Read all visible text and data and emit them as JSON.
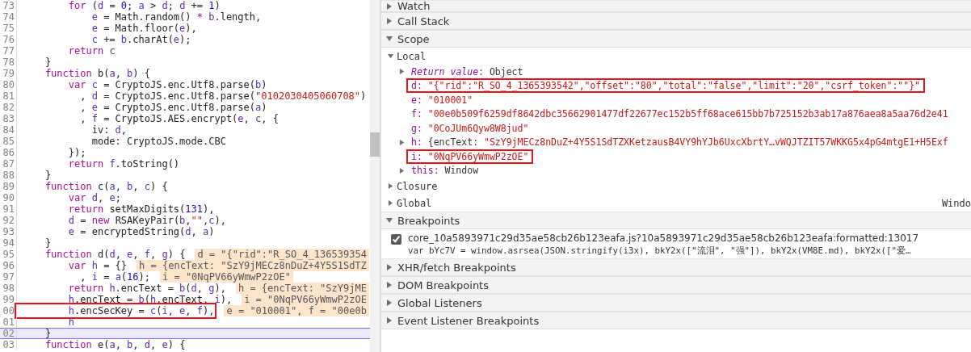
{
  "editor": {
    "lines": [
      {
        "number": "73",
        "tokens": [
          {
            "kind": "keyword",
            "text": "        for"
          },
          {
            "kind": "plain",
            "text": " ("
          },
          {
            "kind": "variable",
            "text": "d"
          },
          {
            "kind": "plain",
            "text": " = "
          },
          {
            "kind": "number",
            "text": "0"
          },
          {
            "kind": "plain",
            "text": "; "
          },
          {
            "kind": "variable",
            "text": "a"
          },
          {
            "kind": "plain",
            "text": " > "
          },
          {
            "kind": "variable",
            "text": "d"
          },
          {
            "kind": "plain",
            "text": "; "
          },
          {
            "kind": "variable",
            "text": "d"
          },
          {
            "kind": "plain",
            "text": " += "
          },
          {
            "kind": "number",
            "text": "1"
          },
          {
            "kind": "plain",
            "text": ")"
          }
        ]
      },
      {
        "number": "74",
        "tokens": [
          {
            "kind": "variable",
            "text": "            e"
          },
          {
            "kind": "plain",
            "text": " = Math.random() "
          },
          {
            "kind": "keyword",
            "text": "*"
          },
          {
            "kind": "variable",
            "text": " b"
          },
          {
            "kind": "plain",
            "text": ".length,"
          }
        ]
      },
      {
        "number": "75",
        "tokens": [
          {
            "kind": "variable",
            "text": "            e"
          },
          {
            "kind": "plain",
            "text": " = Math.floor("
          },
          {
            "kind": "variable",
            "text": "e"
          },
          {
            "kind": "plain",
            "text": "),"
          }
        ]
      },
      {
        "number": "76",
        "tokens": [
          {
            "kind": "variable",
            "text": "            c"
          },
          {
            "kind": "plain",
            "text": " += "
          },
          {
            "kind": "variable",
            "text": "b"
          },
          {
            "kind": "plain",
            "text": ".charAt("
          },
          {
            "kind": "variable",
            "text": "e"
          },
          {
            "kind": "plain",
            "text": ");"
          }
        ]
      },
      {
        "number": "77",
        "tokens": [
          {
            "kind": "keyword",
            "text": "        return"
          },
          {
            "kind": "variable",
            "text": " c"
          }
        ]
      },
      {
        "number": "78",
        "tokens": [
          {
            "kind": "plain",
            "text": "    }"
          }
        ]
      },
      {
        "number": "79",
        "tokens": [
          {
            "kind": "keyword",
            "text": "    function"
          },
          {
            "kind": "plain",
            "text": " b("
          },
          {
            "kind": "variable",
            "text": "a"
          },
          {
            "kind": "plain",
            "text": ", "
          },
          {
            "kind": "variable",
            "text": "b"
          },
          {
            "kind": "plain",
            "text": ") {"
          }
        ]
      },
      {
        "number": "80",
        "tokens": [
          {
            "kind": "keyword",
            "text": "        var"
          },
          {
            "kind": "variable",
            "text": " c"
          },
          {
            "kind": "plain",
            "text": " = CryptoJS.enc.Utf8.parse("
          },
          {
            "kind": "variable",
            "text": "b"
          },
          {
            "kind": "plain",
            "text": ")"
          }
        ]
      },
      {
        "number": "81",
        "tokens": [
          {
            "kind": "plain",
            "text": "          , "
          },
          {
            "kind": "variable",
            "text": "d"
          },
          {
            "kind": "plain",
            "text": " = CryptoJS.enc.Utf8.parse("
          },
          {
            "kind": "string",
            "text": "\"0102030405060708\""
          },
          {
            "kind": "plain",
            "text": ")"
          }
        ]
      },
      {
        "number": "82",
        "tokens": [
          {
            "kind": "plain",
            "text": "          , "
          },
          {
            "kind": "variable",
            "text": "e"
          },
          {
            "kind": "plain",
            "text": " = CryptoJS.enc.Utf8.parse("
          },
          {
            "kind": "variable",
            "text": "a"
          },
          {
            "kind": "plain",
            "text": ")"
          }
        ]
      },
      {
        "number": "83",
        "tokens": [
          {
            "kind": "plain",
            "text": "          , "
          },
          {
            "kind": "variable",
            "text": "f"
          },
          {
            "kind": "plain",
            "text": " = CryptoJS.AES.encrypt("
          },
          {
            "kind": "variable",
            "text": "e"
          },
          {
            "kind": "plain",
            "text": ", "
          },
          {
            "kind": "variable",
            "text": "c"
          },
          {
            "kind": "plain",
            "text": ", {"
          }
        ]
      },
      {
        "number": "84",
        "tokens": [
          {
            "kind": "plain",
            "text": "            iv: "
          },
          {
            "kind": "variable",
            "text": "d"
          },
          {
            "kind": "plain",
            "text": ","
          }
        ]
      },
      {
        "number": "85",
        "tokens": [
          {
            "kind": "plain",
            "text": "            mode: CryptoJS.mode.CBC"
          }
        ]
      },
      {
        "number": "86",
        "tokens": [
          {
            "kind": "plain",
            "text": "        });"
          }
        ]
      },
      {
        "number": "87",
        "tokens": [
          {
            "kind": "keyword",
            "text": "        return"
          },
          {
            "kind": "variable",
            "text": " f"
          },
          {
            "kind": "plain",
            "text": ".toString()"
          }
        ]
      },
      {
        "number": "88",
        "tokens": [
          {
            "kind": "plain",
            "text": "    }"
          }
        ]
      },
      {
        "number": "89",
        "tokens": [
          {
            "kind": "keyword",
            "text": "    function"
          },
          {
            "kind": "plain",
            "text": " c("
          },
          {
            "kind": "variable",
            "text": "a"
          },
          {
            "kind": "plain",
            "text": ", "
          },
          {
            "kind": "variable",
            "text": "b"
          },
          {
            "kind": "plain",
            "text": ", "
          },
          {
            "kind": "variable",
            "text": "c"
          },
          {
            "kind": "plain",
            "text": ") {"
          }
        ]
      },
      {
        "number": "90",
        "tokens": [
          {
            "kind": "keyword",
            "text": "        var"
          },
          {
            "kind": "variable",
            "text": " d"
          },
          {
            "kind": "plain",
            "text": ", "
          },
          {
            "kind": "variable",
            "text": "e"
          },
          {
            "kind": "plain",
            "text": ";"
          }
        ]
      },
      {
        "number": "91",
        "tokens": [
          {
            "kind": "keyword",
            "text": "        return"
          },
          {
            "kind": "plain",
            "text": " setMaxDigits("
          },
          {
            "kind": "number",
            "text": "131"
          },
          {
            "kind": "plain",
            "text": "),"
          }
        ]
      },
      {
        "number": "92",
        "tokens": [
          {
            "kind": "variable",
            "text": "        d"
          },
          {
            "kind": "plain",
            "text": " = "
          },
          {
            "kind": "keyword",
            "text": "new"
          },
          {
            "kind": "plain",
            "text": " RSAKeyPair("
          },
          {
            "kind": "variable",
            "text": "b"
          },
          {
            "kind": "plain",
            "text": ","
          },
          {
            "kind": "string",
            "text": "\"\""
          },
          {
            "kind": "plain",
            "text": ","
          },
          {
            "kind": "variable",
            "text": "c"
          },
          {
            "kind": "plain",
            "text": "),"
          }
        ]
      },
      {
        "number": "93",
        "tokens": [
          {
            "kind": "variable",
            "text": "        e"
          },
          {
            "kind": "plain",
            "text": " = encryptedString("
          },
          {
            "kind": "variable",
            "text": "d"
          },
          {
            "kind": "plain",
            "text": ", "
          },
          {
            "kind": "variable",
            "text": "a"
          },
          {
            "kind": "plain",
            "text": ")"
          }
        ]
      },
      {
        "number": "94",
        "tokens": [
          {
            "kind": "plain",
            "text": "    }"
          }
        ]
      },
      {
        "number": "95",
        "tokens": [
          {
            "kind": "keyword",
            "text": "    function"
          },
          {
            "kind": "plain",
            "text": " d("
          },
          {
            "kind": "variable",
            "text": "d"
          },
          {
            "kind": "plain",
            "text": ", "
          },
          {
            "kind": "variable",
            "text": "e"
          },
          {
            "kind": "plain",
            "text": ", "
          },
          {
            "kind": "variable",
            "text": "f"
          },
          {
            "kind": "plain",
            "text": ", "
          },
          {
            "kind": "variable",
            "text": "g"
          },
          {
            "kind": "plain",
            "text": ") {"
          }
        ],
        "inline_value": "d = \"{\"rid\":\"R_SO_4_136539354"
      },
      {
        "number": "96",
        "tokens": [
          {
            "kind": "keyword",
            "text": "        var"
          },
          {
            "kind": "variable",
            "text": " h"
          },
          {
            "kind": "plain",
            "text": " = {}"
          }
        ],
        "inline_value": "h = {encText: \"SzY9jMECz8nDuZ+4Y5S1SdTZ"
      },
      {
        "number": "97",
        "tokens": [
          {
            "kind": "plain",
            "text": "          , "
          },
          {
            "kind": "variable",
            "text": "i"
          },
          {
            "kind": "plain",
            "text": " = "
          },
          {
            "kind": "variable",
            "text": "a"
          },
          {
            "kind": "plain",
            "text": "("
          },
          {
            "kind": "number",
            "text": "16"
          },
          {
            "kind": "plain",
            "text": ");"
          }
        ],
        "inline_value": "i = \"0NqPV66yWmwP2zOE\""
      },
      {
        "number": "98",
        "tokens": [
          {
            "kind": "keyword",
            "text": "        return"
          },
          {
            "kind": "variable",
            "text": " h"
          },
          {
            "kind": "plain",
            "text": ".encText = "
          },
          {
            "kind": "variable",
            "text": "b"
          },
          {
            "kind": "plain",
            "text": "("
          },
          {
            "kind": "variable",
            "text": "d"
          },
          {
            "kind": "plain",
            "text": ", "
          },
          {
            "kind": "variable",
            "text": "g"
          },
          {
            "kind": "plain",
            "text": "),"
          }
        ],
        "inline_value": "h = {encText: \"SzY9jME"
      },
      {
        "number": "99",
        "tokens": [
          {
            "kind": "variable",
            "text": "        h"
          },
          {
            "kind": "plain",
            "text": ".encText = "
          },
          {
            "kind": "variable",
            "text": "b"
          },
          {
            "kind": "plain",
            "text": "("
          },
          {
            "kind": "variable",
            "text": "h"
          },
          {
            "kind": "plain",
            "text": ".encText, "
          },
          {
            "kind": "variable",
            "text": "i"
          },
          {
            "kind": "plain",
            "text": "),"
          }
        ],
        "inline_value": "i = \"0NqPV66yWmwP2zOE"
      },
      {
        "number": "00",
        "tokens": [
          {
            "kind": "variable",
            "text": "        h"
          },
          {
            "kind": "plain",
            "text": ".encSecKey = "
          },
          {
            "kind": "variable",
            "text": "c"
          },
          {
            "kind": "plain",
            "text": "("
          },
          {
            "kind": "variable",
            "text": "i"
          },
          {
            "kind": "plain",
            "text": ", "
          },
          {
            "kind": "variable",
            "text": "e"
          },
          {
            "kind": "plain",
            "text": ", "
          },
          {
            "kind": "variable",
            "text": "f"
          },
          {
            "kind": "plain",
            "text": "),"
          }
        ],
        "inline_value": "e = \"010001\", f = \"00e0b",
        "outlined": true
      },
      {
        "number": "01",
        "tokens": [
          {
            "kind": "variable",
            "text": "        h"
          }
        ]
      },
      {
        "number": "02",
        "tokens": [
          {
            "kind": "plain",
            "text": "    }"
          }
        ],
        "current": true
      },
      {
        "number": "03",
        "tokens": [
          {
            "kind": "keyword",
            "text": "    function"
          },
          {
            "kind": "plain",
            "text": " e("
          },
          {
            "kind": "variable",
            "text": "a"
          },
          {
            "kind": "plain",
            "text": ", "
          },
          {
            "kind": "variable",
            "text": "b"
          },
          {
            "kind": "plain",
            "text": ", "
          },
          {
            "kind": "variable",
            "text": "d"
          },
          {
            "kind": "plain",
            "text": ", "
          },
          {
            "kind": "variable",
            "text": "e"
          },
          {
            "kind": "plain",
            "text": ") {"
          }
        ]
      }
    ]
  },
  "sidebar": {
    "sections": [
      {
        "title": "Watch",
        "expanded": false
      },
      {
        "title": "Call Stack",
        "expanded": false
      },
      {
        "title": "Scope",
        "expanded": true,
        "scopes": [
          {
            "title": "Local",
            "expanded": true,
            "items": [
              {
                "key": "*Return value*:",
                "value": "Object",
                "kind": "object",
                "expandable": true
              },
              {
                "key": "d:",
                "value": "\"{\"rid\":\"R_SO_4_1365393542\",\"offset\":\"80\",\"total\":\"false\",\"limit\":\"20\",\"csrf_token\":\"\"}\"",
                "kind": "string",
                "outlined": true
              },
              {
                "key": "e:",
                "value": "\"010001\"",
                "kind": "string"
              },
              {
                "key": "f:",
                "value": "\"00e0b509f6259df8642dbc35662901477df22677ec152b5ff68ace615bb7b725152b3ab17a876aea8a5aa76d2e41",
                "kind": "string"
              },
              {
                "key": "g:",
                "value": "\"0CoJUm6Qyw8W8jud\"",
                "kind": "string"
              },
              {
                "key": "h:",
                "value": "{encText: ",
                "value_tail": "\"SzY9jMECz8nDuZ+4Y5S1SdTZXKetzausB4VY9hYJb6UxcXbrtY…vWQJTZIT57WKKG5x4pG4mtgE1+H5Exf",
                "kind": "object",
                "expandable": true
              },
              {
                "key": "i:",
                "value": "\"0NqPV66yWmwP2zOE\"",
                "kind": "string",
                "outlined": true
              },
              {
                "key": "this:",
                "value": "Window",
                "kind": "object",
                "expandable": true
              }
            ]
          },
          {
            "title": "Closure",
            "expanded": false
          },
          {
            "title": "Global",
            "expanded": false,
            "value": "Windo"
          }
        ]
      },
      {
        "title": "Breakpoints",
        "expanded": true,
        "breakpoints": [
          {
            "checked": true,
            "location": "core_10a5893971c29d35ae58cb26b123eafa.js?10a5893971c29d35ae58cb26b123eafa:formatted:13017",
            "code": "var bYc7V = window.asrsea(JSON.stringify(i3x), bkY2x([\"流泪\", \"强\"]), bkY2x(VM8E.md), bkY2x([\"爱…"
          }
        ]
      },
      {
        "title": "XHR/fetch Breakpoints",
        "expanded": false
      },
      {
        "title": "DOM Breakpoints",
        "expanded": false
      },
      {
        "title": "Global Listeners",
        "expanded": false
      },
      {
        "title": "Event Listener Breakpoints",
        "expanded": false
      }
    ]
  }
}
